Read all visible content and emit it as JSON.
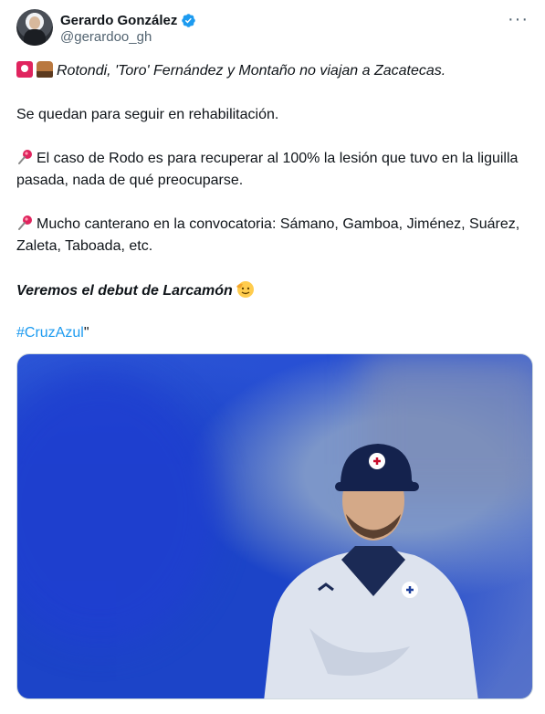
{
  "author": {
    "name": "Gerardo González",
    "handle": "@gerardoo_gh",
    "verified": true,
    "avatar_icon": "avatar"
  },
  "more_label": "···",
  "tweet": {
    "line1": "Rotondi, 'Toro' Fernández y Montaño no viajan a Zacatecas.",
    "line2": "Se quedan para seguir en rehabilitación.",
    "line3": "El caso de Rodo es para recuperar al 100% la lesión que tuvo en la liguilla pasada, nada de qué preocuparse.",
    "line4": "Mucho canterano en la convocatoria: Sámano, Gamboa, Jiménez, Suárez, Zaleta, Taboada, etc.",
    "line5": "Veremos el debut de Larcamón",
    "hashtag": "#CruzAzul",
    "hashtag_suffix": "\""
  },
  "colors": {
    "accent": "#1d9bf0",
    "text": "#0f1419",
    "muted": "#536471"
  },
  "icons": {
    "verified": "verified-badge-icon",
    "more": "more-options-icon",
    "pin": "pushpin-icon",
    "smile": "smiling-face-icon"
  }
}
